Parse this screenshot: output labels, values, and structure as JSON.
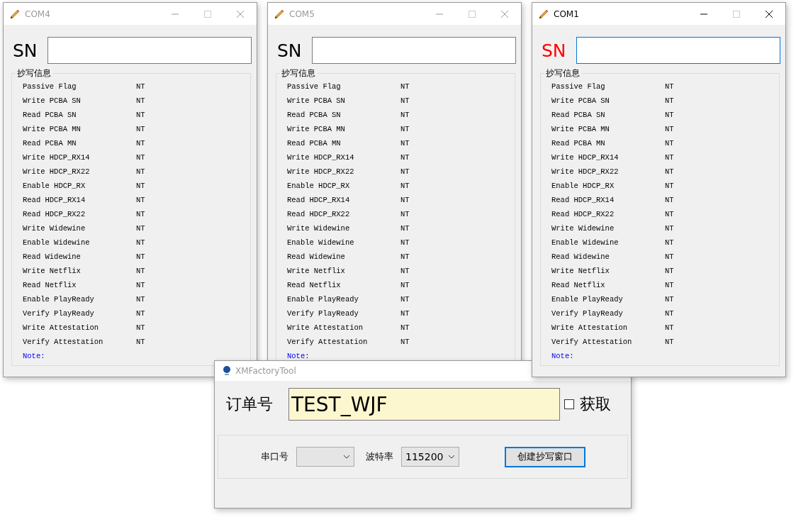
{
  "com_windows": [
    {
      "title": "COM4",
      "active": false,
      "sn_label": "SN",
      "sn_alert": false,
      "sn_focused": false,
      "group_title": "抄写信息",
      "rows": [
        {
          "label": "Passive Flag",
          "status": "NT"
        },
        {
          "label": "Write PCBA SN",
          "status": "NT"
        },
        {
          "label": "Read PCBA SN",
          "status": "NT"
        },
        {
          "label": "Write PCBA MN",
          "status": "NT"
        },
        {
          "label": "Read PCBA MN",
          "status": "NT"
        },
        {
          "label": "Write HDCP_RX14",
          "status": "NT"
        },
        {
          "label": "Write HDCP_RX22",
          "status": "NT"
        },
        {
          "label": "Enable HDCP_RX",
          "status": "NT"
        },
        {
          "label": "Read HDCP_RX14",
          "status": "NT"
        },
        {
          "label": "Read HDCP_RX22",
          "status": "NT"
        },
        {
          "label": "Write Widewine",
          "status": "NT"
        },
        {
          "label": "Enable Widewine",
          "status": "NT"
        },
        {
          "label": "Read Widewine",
          "status": "NT"
        },
        {
          "label": "Write Netflix",
          "status": "NT"
        },
        {
          "label": "Read Netflix",
          "status": "NT"
        },
        {
          "label": "Enable PlayReady",
          "status": "NT"
        },
        {
          "label": "Verify PlayReady",
          "status": "NT"
        },
        {
          "label": "Write Attestation",
          "status": "NT"
        },
        {
          "label": "Verify Attestation",
          "status": "NT"
        }
      ],
      "note": "Note:"
    },
    {
      "title": "COM5",
      "active": false,
      "sn_label": "SN",
      "sn_alert": false,
      "sn_focused": false,
      "group_title": "抄写信息",
      "rows": [
        {
          "label": "Passive Flag",
          "status": "NT"
        },
        {
          "label": "Write PCBA SN",
          "status": "NT"
        },
        {
          "label": "Read PCBA SN",
          "status": "NT"
        },
        {
          "label": "Write PCBA MN",
          "status": "NT"
        },
        {
          "label": "Read PCBA MN",
          "status": "NT"
        },
        {
          "label": "Write HDCP_RX14",
          "status": "NT"
        },
        {
          "label": "Write HDCP_RX22",
          "status": "NT"
        },
        {
          "label": "Enable HDCP_RX",
          "status": "NT"
        },
        {
          "label": "Read HDCP_RX14",
          "status": "NT"
        },
        {
          "label": "Read HDCP_RX22",
          "status": "NT"
        },
        {
          "label": "Write Widewine",
          "status": "NT"
        },
        {
          "label": "Enable Widewine",
          "status": "NT"
        },
        {
          "label": "Read Widewine",
          "status": "NT"
        },
        {
          "label": "Write Netflix",
          "status": "NT"
        },
        {
          "label": "Read Netflix",
          "status": "NT"
        },
        {
          "label": "Enable PlayReady",
          "status": "NT"
        },
        {
          "label": "Verify PlayReady",
          "status": "NT"
        },
        {
          "label": "Write Attestation",
          "status": "NT"
        },
        {
          "label": "Verify Attestation",
          "status": "NT"
        }
      ],
      "note": "Note:"
    },
    {
      "title": "COM1",
      "active": true,
      "sn_label": "SN",
      "sn_alert": true,
      "sn_focused": true,
      "group_title": "抄写信息",
      "rows": [
        {
          "label": "Passive Flag",
          "status": "NT"
        },
        {
          "label": "Write PCBA SN",
          "status": "NT"
        },
        {
          "label": "Read PCBA SN",
          "status": "NT"
        },
        {
          "label": "Write PCBA MN",
          "status": "NT"
        },
        {
          "label": "Read PCBA MN",
          "status": "NT"
        },
        {
          "label": "Write HDCP_RX14",
          "status": "NT"
        },
        {
          "label": "Write HDCP_RX22",
          "status": "NT"
        },
        {
          "label": "Enable HDCP_RX",
          "status": "NT"
        },
        {
          "label": "Read HDCP_RX14",
          "status": "NT"
        },
        {
          "label": "Read HDCP_RX22",
          "status": "NT"
        },
        {
          "label": "Write Widewine",
          "status": "NT"
        },
        {
          "label": "Enable Widewine",
          "status": "NT"
        },
        {
          "label": "Read Widewine",
          "status": "NT"
        },
        {
          "label": "Write Netflix",
          "status": "NT"
        },
        {
          "label": "Read Netflix",
          "status": "NT"
        },
        {
          "label": "Enable PlayReady",
          "status": "NT"
        },
        {
          "label": "Verify PlayReady",
          "status": "NT"
        },
        {
          "label": "Write Attestation",
          "status": "NT"
        },
        {
          "label": "Verify Attestation",
          "status": "NT"
        }
      ],
      "note": "Note:"
    }
  ],
  "main_window": {
    "title": "XMFactoryTool",
    "active": false,
    "order_label": "订单号",
    "order_value": "TEST_WJF",
    "fetch": {
      "label": "获取",
      "checked": false
    },
    "port_label": "串口号",
    "baud_label": "波特率",
    "baud_value": "115200",
    "create_button": {
      "label": "创建抄写窗口",
      "focused": true
    }
  }
}
